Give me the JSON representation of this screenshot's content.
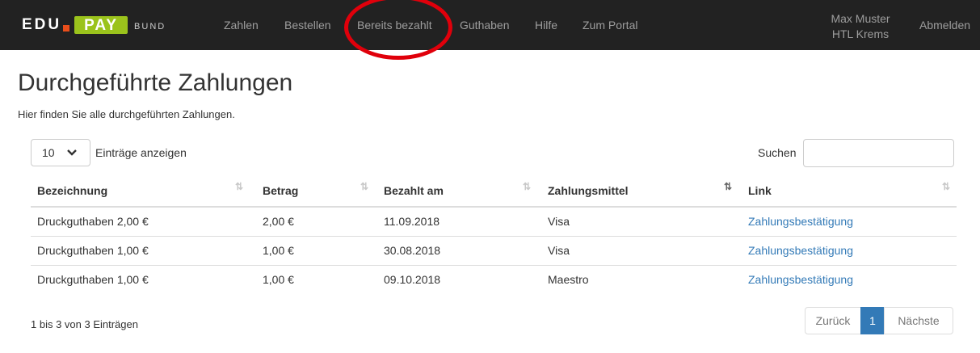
{
  "brand": {
    "edu": "EDU",
    "pay": "PAY",
    "bund": "BUND",
    "accent": "#9bc31c",
    "dot_color": "#e94e1b"
  },
  "nav": {
    "items": [
      {
        "label": "Zahlen"
      },
      {
        "label": "Bestellen"
      },
      {
        "label": "Bereits bezahlt"
      },
      {
        "label": "Guthaben"
      },
      {
        "label": "Hilfe"
      },
      {
        "label": "Zum Portal"
      }
    ],
    "user_name": "Max Muster",
    "user_school": "HTL Krems",
    "logout": "Abmelden",
    "highlight_color": "#e0000b"
  },
  "page": {
    "title": "Durchgeführte Zahlungen",
    "subtitle": "Hier finden Sie alle durchgeführten Zahlungen."
  },
  "controls": {
    "page_length": "10",
    "page_length_label": "Einträge anzeigen",
    "search_label": "Suchen",
    "search_value": ""
  },
  "table": {
    "headers": [
      "Bezeichnung",
      "Betrag",
      "Bezahlt am",
      "Zahlungsmittel",
      "Link"
    ],
    "sort_icon": "⇅",
    "rows": [
      {
        "name": "Druckguthaben 2,00 €",
        "amount": "2,00 €",
        "date": "11.09.2018",
        "method": "Visa",
        "link": "Zahlungsbestätigung"
      },
      {
        "name": "Druckguthaben 1,00 €",
        "amount": "1,00 €",
        "date": "30.08.2018",
        "method": "Visa",
        "link": "Zahlungsbestätigung"
      },
      {
        "name": "Druckguthaben 1,00 €",
        "amount": "1,00 €",
        "date": "09.10.2018",
        "method": "Maestro",
        "link": "Zahlungsbestätigung"
      }
    ]
  },
  "footer": {
    "info": "1 bis 3 von 3 Einträgen",
    "prev": "Zurück",
    "current": "1",
    "next": "Nächste",
    "active_color": "#337ab7"
  }
}
